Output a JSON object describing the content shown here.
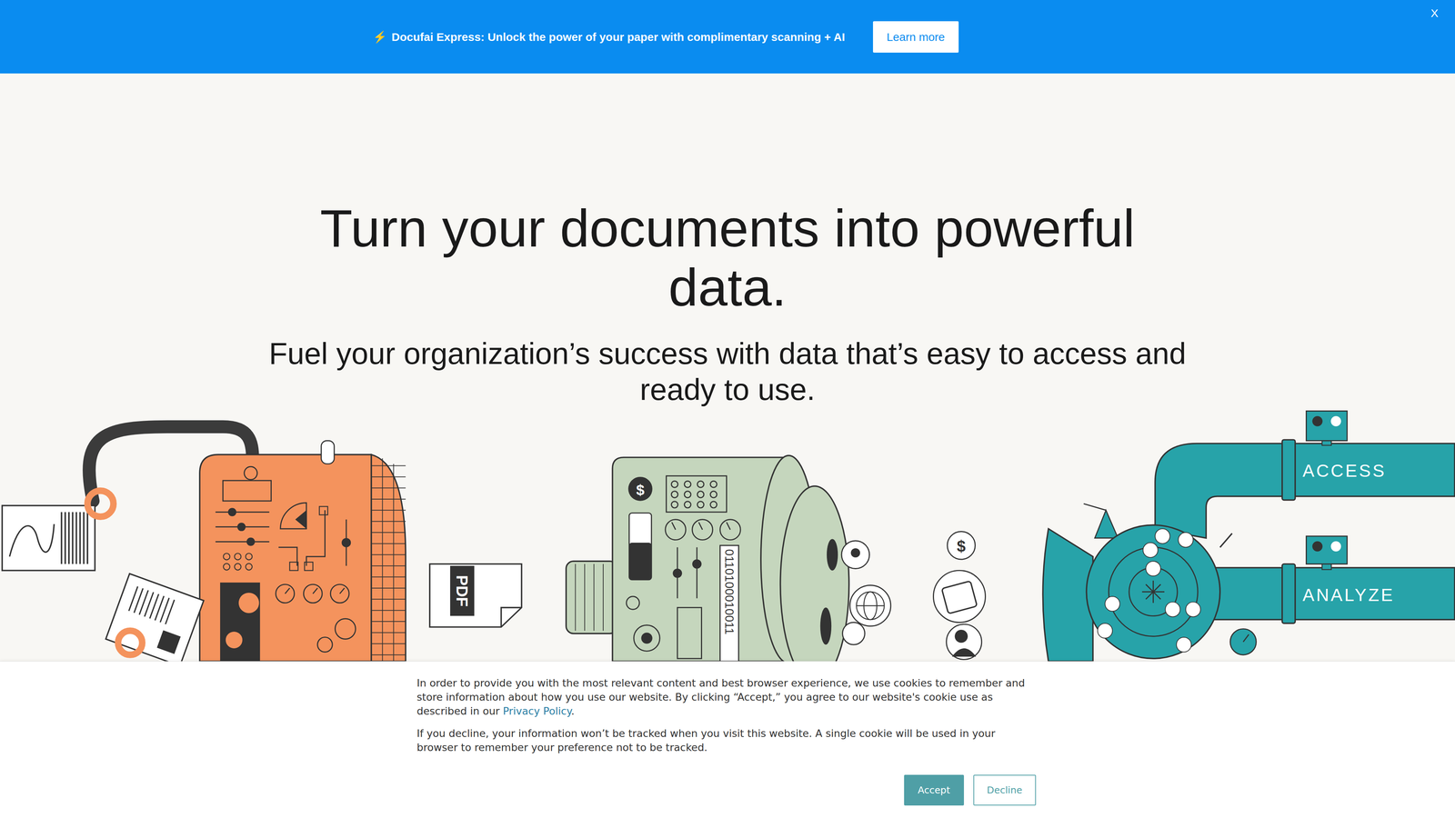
{
  "banner": {
    "icon": "⚡",
    "text": "Docufai Express: Unlock the power of your paper with complimentary scanning + AI",
    "button": "Learn more",
    "close": "X"
  },
  "hero": {
    "title": "Turn your documents into powerful data.",
    "subtitle": "Fuel your organization’s success with data that’s easy to access and ready to use."
  },
  "illustration": {
    "document_label": "PDF",
    "currency_symbols": [
      "$",
      "$"
    ],
    "binary": "0110100010011",
    "pipes": [
      "ACCESS",
      "ANALYZE"
    ]
  },
  "cookie_banner": {
    "paragraph_1_before": "In order to provide you with the most relevant content and best browser experience, we use cookies to remember and store information about how you use our website. By clicking “Accept,” you agree to our website's cookie use as described in our ",
    "link": "Privacy Policy",
    "paragraph_1_after": ".",
    "paragraph_2": "If you decline, your information won’t be tracked when you visit this website. A single cookie will be used in your browser to remember your preference not to be tracked.",
    "buttons": [
      {
        "label": "Accept",
        "primary": true
      },
      {
        "label": "Decline",
        "primary": false
      }
    ]
  }
}
